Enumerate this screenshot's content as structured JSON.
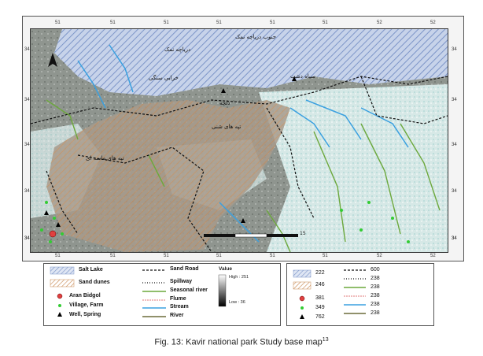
{
  "map": {
    "top_ticks": [
      "51",
      "51",
      "51",
      "51",
      "51",
      "51",
      "52",
      "52"
    ],
    "bottom_ticks": [
      "51",
      "51",
      "51",
      "51",
      "51",
      "51",
      "52",
      "52"
    ],
    "left_ticks": [
      "34",
      "34",
      "34",
      "34",
      "34",
      "34"
    ],
    "right_ticks": [
      "34",
      "34",
      "34",
      "34",
      "34",
      "34"
    ],
    "labels": [
      "جنوب دریاچه نمک",
      "دریاچه نمک",
      "خرابی سنگی",
      "سیاه دشت",
      "تپه های ماسه ای",
      "تپه های شنی",
      "دلچه"
    ],
    "scale_label": "15",
    "north_symbol": "north-arrow-icon",
    "colors": {
      "salt_lake": "#b9c7e0",
      "sand_dunes": "#c49a6c",
      "stream": "#3aa0e0",
      "seasonal_river": "#6ca83c",
      "sand_road": "#111111",
      "village": "#33cc33",
      "aran_bidgol": "#e04040"
    }
  },
  "legend_left": {
    "salt_lake": "Salt Lake",
    "sand_dunes": "Sand dunes",
    "aran_bidgol": "Aran Bidgol",
    "village": "Village, Farm",
    "well": "Well, Spring",
    "sand_road": "Sand Road",
    "spillway": "Spillway",
    "seasonal_river": "Seasonal river",
    "flume": "Flume",
    "stream": "Stream",
    "river": "River",
    "value_title": "Value",
    "value_high": "High : 251",
    "value_low": "Low : 36"
  },
  "legend_right": {
    "items_left": [
      "222",
      "246",
      "381",
      "349",
      "762"
    ],
    "items_right": [
      "600",
      "238",
      "238",
      "238",
      "238",
      "238"
    ]
  },
  "caption": {
    "text": "Fig. 13: Kavir national park Study base map",
    "sup": "13"
  }
}
